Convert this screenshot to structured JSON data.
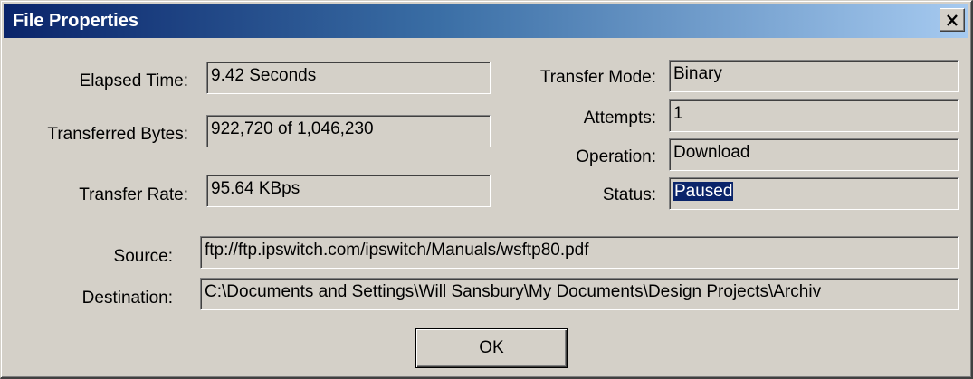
{
  "window": {
    "title": "File Properties",
    "close_glyph": "×",
    "close_icon": "close-icon"
  },
  "fields": {
    "elapsed_time": {
      "label": "Elapsed Time:",
      "value": "9.42 Seconds"
    },
    "transferred_bytes": {
      "label": "Transferred Bytes:",
      "value": "922,720 of 1,046,230"
    },
    "transfer_rate": {
      "label": "Transfer Rate:",
      "value": "95.64 KBps"
    },
    "transfer_mode": {
      "label": "Transfer Mode:",
      "value": "Binary"
    },
    "attempts": {
      "label": "Attempts:",
      "value": "1"
    },
    "operation": {
      "label": "Operation:",
      "value": "Download"
    },
    "status": {
      "label": "Status:",
      "value": "Paused"
    },
    "source": {
      "label": "Source:",
      "value": "ftp://ftp.ipswitch.com/ipswitch/Manuals/wsftp80.pdf"
    },
    "destination": {
      "label": "Destination:",
      "value": "C:\\Documents and Settings\\Will Sansbury\\My Documents\\Design Projects\\Archiv"
    }
  },
  "buttons": {
    "ok": "OK"
  },
  "colors": {
    "title_start": "#0a246a",
    "title_end": "#a6caf0",
    "face": "#d4d0c8",
    "selection": "#0a246a"
  }
}
